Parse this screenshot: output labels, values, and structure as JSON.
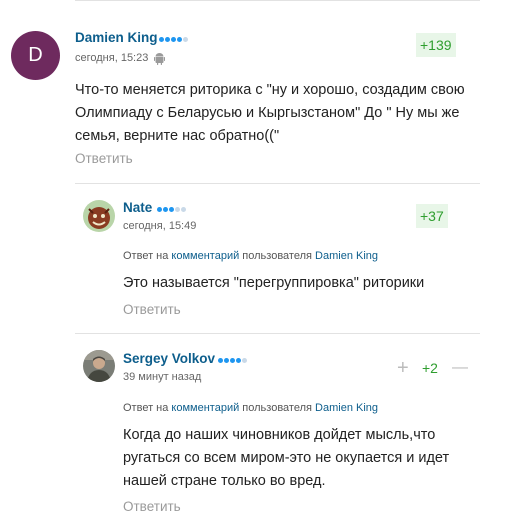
{
  "comments": [
    {
      "author": "Damien King",
      "avatar_letter": "D",
      "rating_dots": 5,
      "rating_on": 4,
      "time": "сегодня, 15:23",
      "device_icon": "android-icon",
      "score": "+139",
      "text": "Что-то меняется риторика с \"ну и хорошо, создадим свою Олимпиаду с Беларусью и Кыргызстаном\" До \" Ну мы же семья, верните нас обратно((\"",
      "reply_label": "Ответить"
    },
    {
      "author": "Nate",
      "rating_dots": 5,
      "rating_on": 3,
      "time": "сегодня, 15:49",
      "score": "+37",
      "reply_prefix": "Ответ на",
      "reply_link": "комментарий",
      "reply_middle": "пользователя",
      "reply_user": "Damien King",
      "text": "Это называется \"перегруппировка\" риторики",
      "reply_label": "Ответить"
    },
    {
      "author": "Sergey Volkov",
      "rating_dots": 5,
      "rating_on": 4,
      "time": "39 минут назад",
      "score": "+2",
      "vote_plus": "+",
      "vote_minus": "—",
      "reply_prefix": "Ответ на",
      "reply_link": "комментарий",
      "reply_middle": "пользователя",
      "reply_user": "Damien King",
      "text": "Когда до наших чиновников дойдет мысль,что ругаться со всем миром-это не окупается и идет нашей стране только во вред.",
      "reply_label": "Ответить"
    }
  ],
  "colors": {
    "username": "#0d5e8c",
    "score_green": "#2f9e2f",
    "score_bg": "#e8f6e8",
    "rating_on": "#1e96f0",
    "rating_off": "#c9d9e8",
    "avatar_bg": "#6e2a5e"
  }
}
